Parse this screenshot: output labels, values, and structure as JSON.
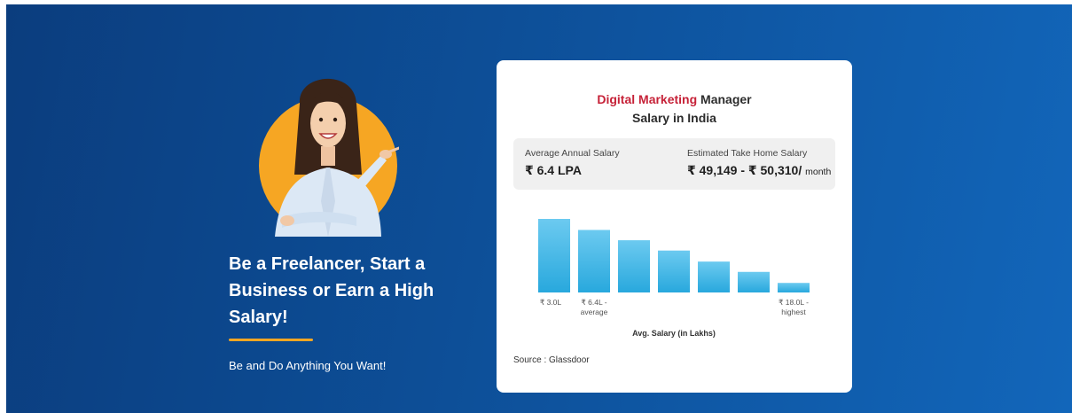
{
  "hero": {
    "headline": "Be a Freelancer, Start a Business or Earn a High Salary!",
    "tagline": "Be and Do Anything You Want!",
    "accent_color": "#f6a623",
    "avatar_icon": "smiling-woman-pointing"
  },
  "card": {
    "title_highlight": "Digital Marketing",
    "title_rest": "Manager",
    "title_line2": "Salary in India",
    "highlight_color": "#c62238",
    "avg_label": "Average Annual Salary",
    "avg_value": "₹ 6.4 LPA",
    "take_home_label": "Estimated Take Home Salary",
    "take_home_value": "₹ 49,149 - ₹ 50,310/",
    "take_home_unit": "month",
    "source": "Source : Glassdoor"
  },
  "chart_data": {
    "type": "bar",
    "values": [
      100,
      85,
      71,
      57,
      42,
      28,
      13
    ],
    "bar_color": "#28a8dd",
    "tick_labels": [
      [
        "₹ 3.0L"
      ],
      [
        "₹ 6.4L -",
        "average"
      ],
      [
        ""
      ],
      [
        ""
      ],
      [
        ""
      ],
      [
        ""
      ],
      [
        "₹ 18.0L -",
        "highest"
      ]
    ],
    "xlabel": "Avg. Salary (in Lakhs)"
  }
}
